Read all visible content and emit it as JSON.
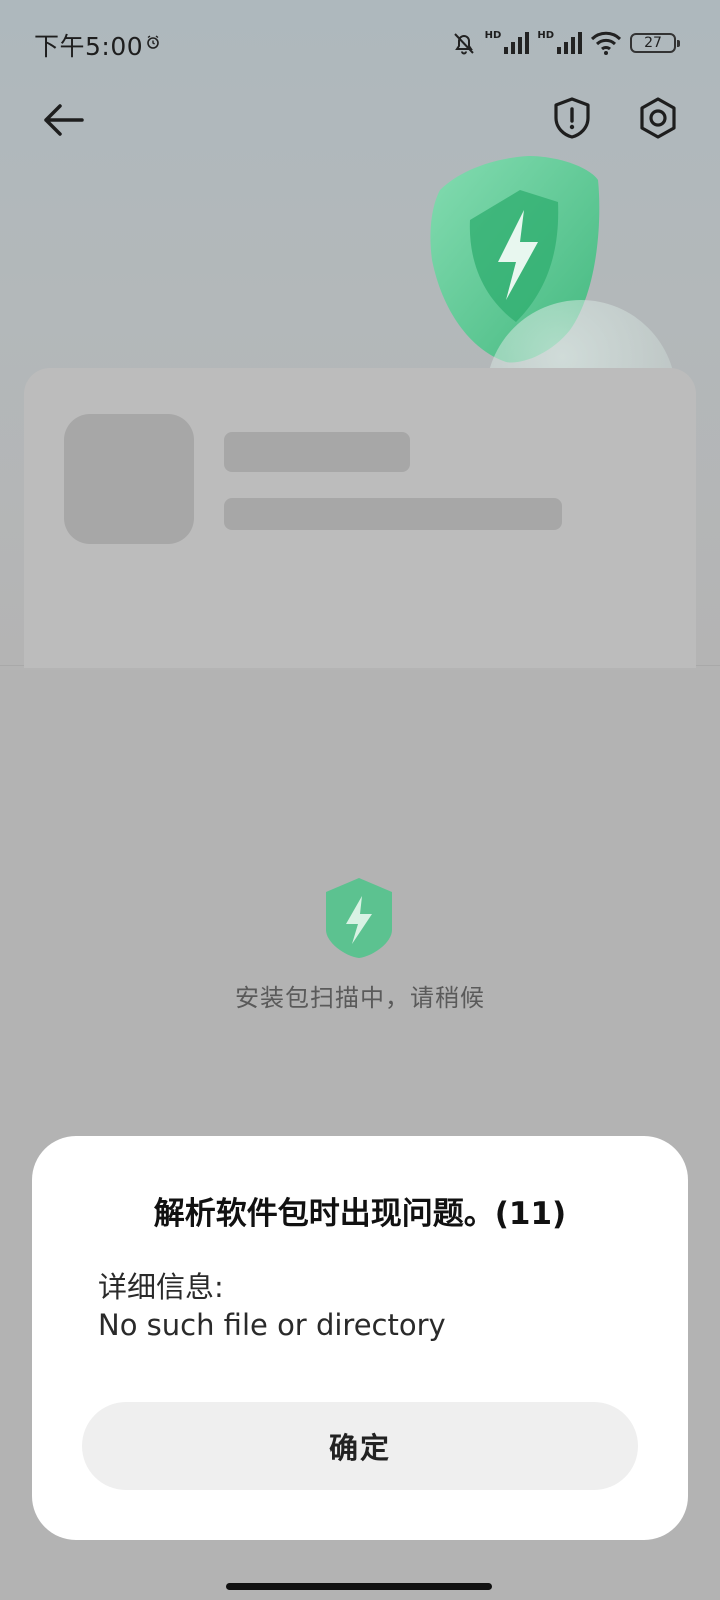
{
  "status_bar": {
    "time": "下午5:00",
    "hd1": "HD",
    "hd2": "HD",
    "battery_level": "27"
  },
  "header": {
    "back_icon": "arrow-left-icon",
    "warning_icon": "shield-exclamation-icon",
    "settings_icon": "gear-icon"
  },
  "scan": {
    "text": "安装包扫描中，请稍候"
  },
  "dialog": {
    "title": "解析软件包时出现问题。(11)",
    "details_label": "详细信息:",
    "details_value": "No such file or directory",
    "confirm_label": "确定"
  },
  "colors": {
    "accent_green": "#3fbf84",
    "dialog_bg": "#ffffff",
    "button_bg": "#efefef"
  }
}
